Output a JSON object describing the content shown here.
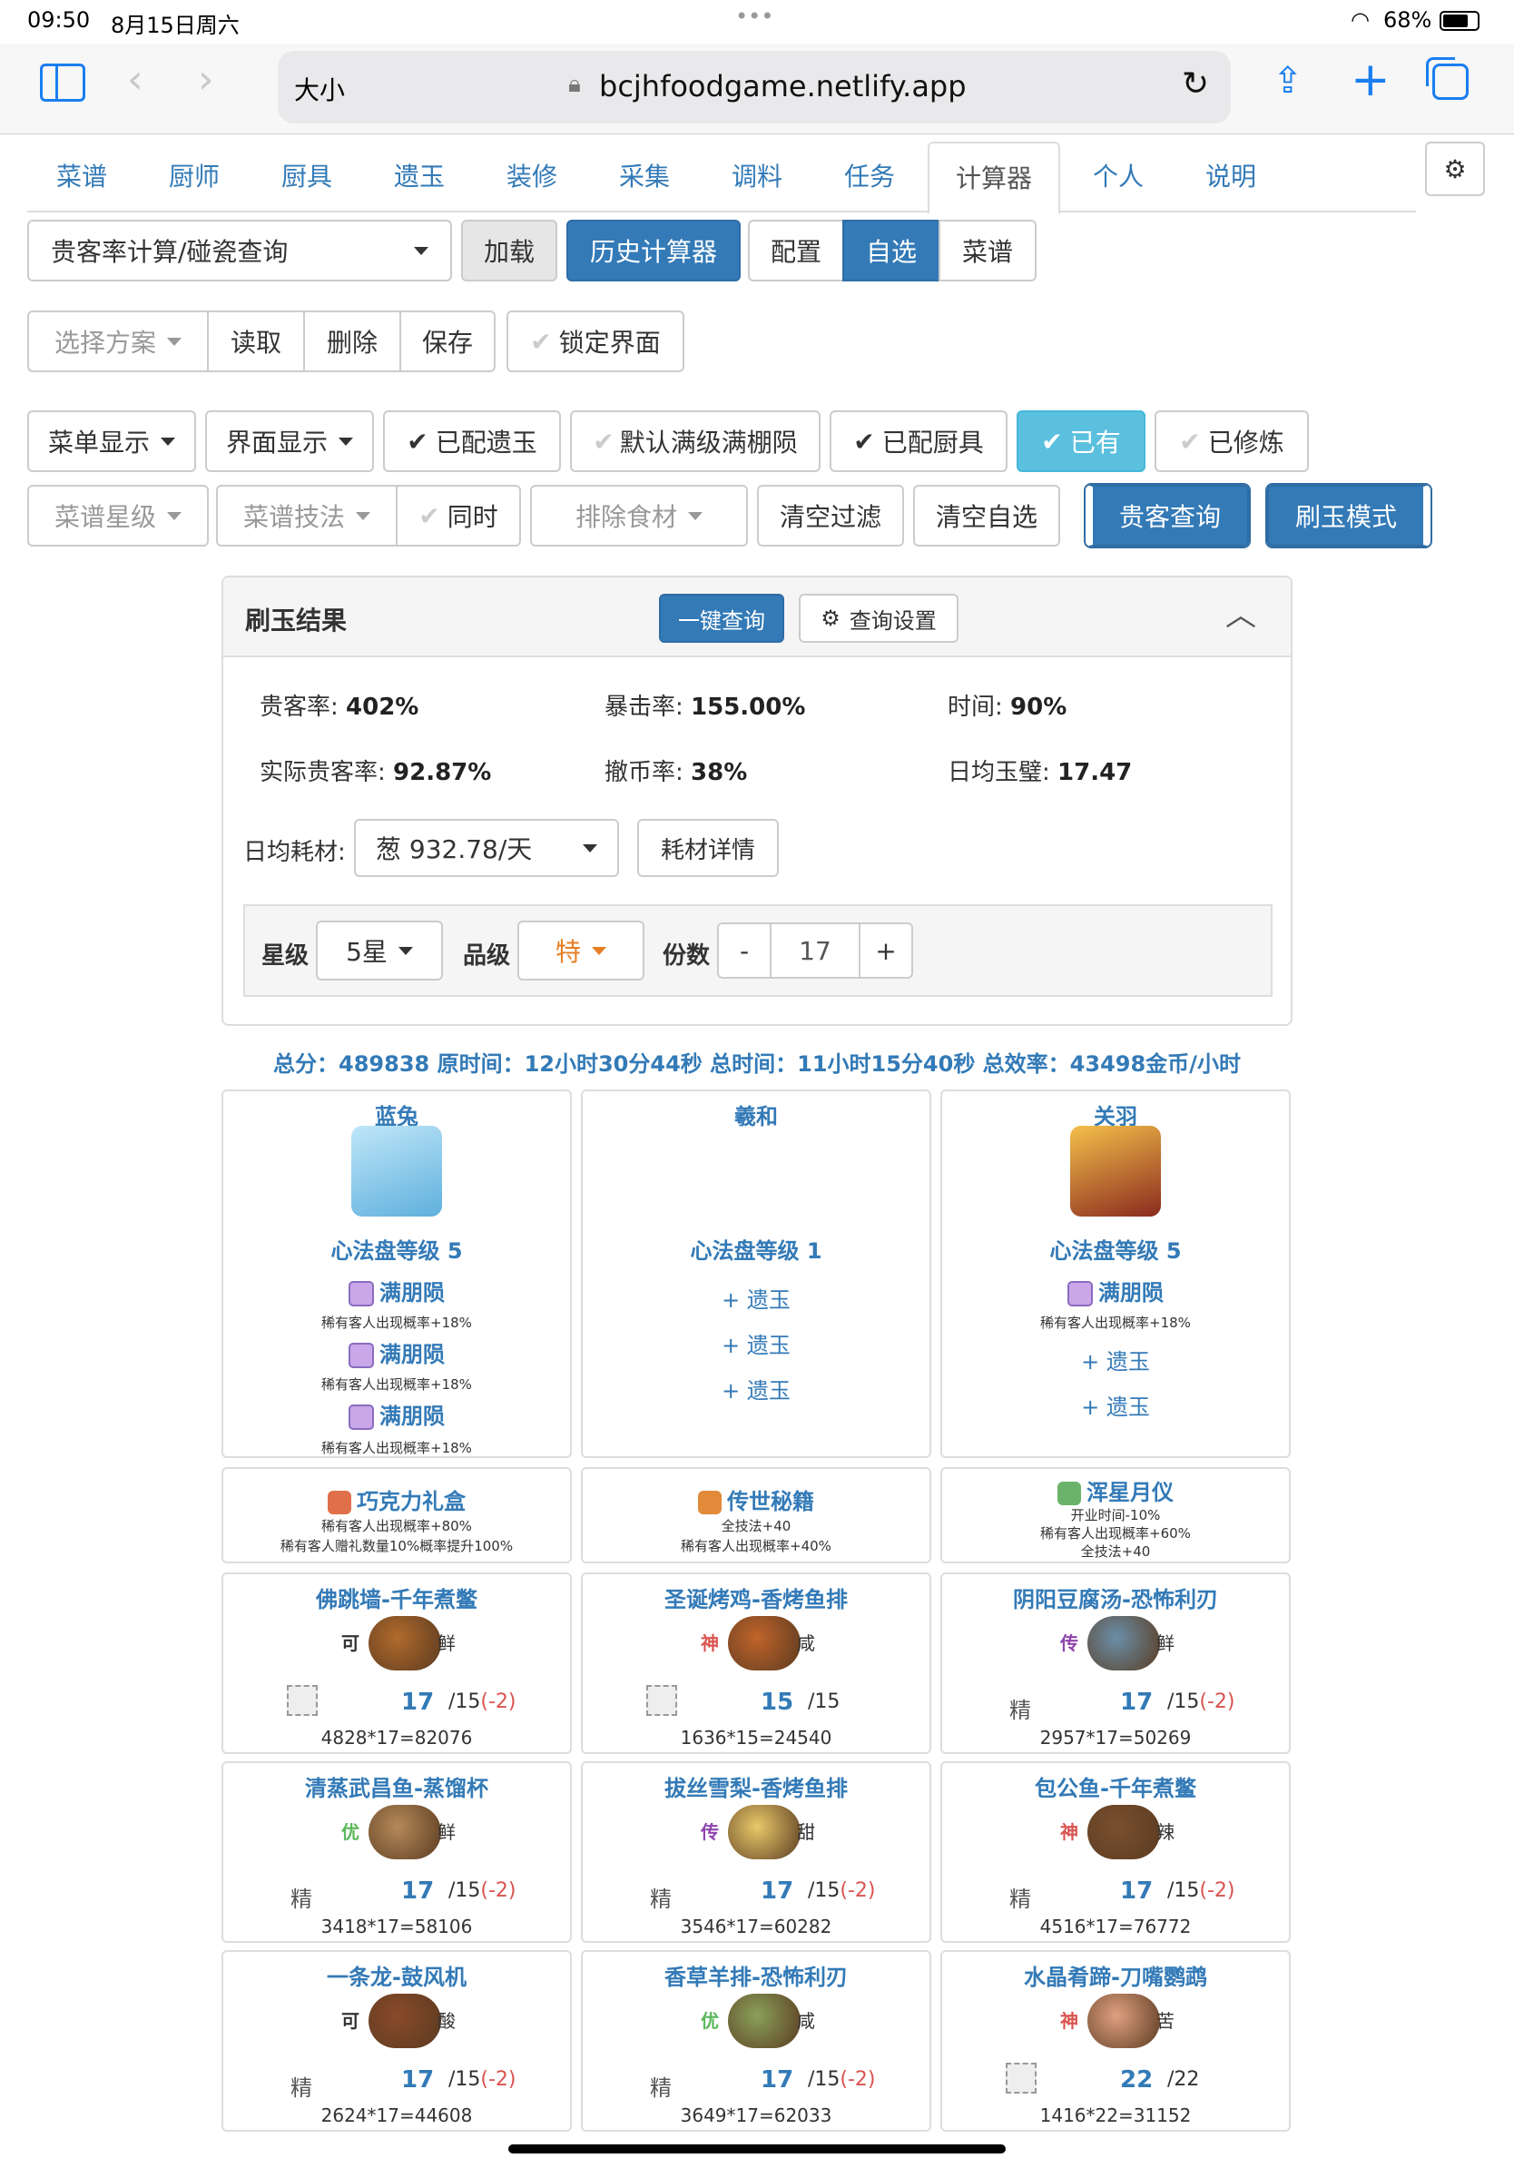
{
  "status": {
    "time": "09:50",
    "date": "8月15日周六",
    "battery": "68%"
  },
  "browser": {
    "text_size": "大小",
    "url": "bcjhfoodgame.netlify.app"
  },
  "tabs": [
    "菜谱",
    "厨师",
    "厨具",
    "遗玉",
    "装修",
    "采集",
    "调料",
    "任务",
    "计算器",
    "个人",
    "说明"
  ],
  "active_tab": "计算器",
  "row1": {
    "calc_select": "贵客率计算/碰瓷查询",
    "load": "加载",
    "history": "历史计算器",
    "config": "配置",
    "custom": "自选",
    "recipes": "菜谱"
  },
  "row2": {
    "plan": "选择方案",
    "read": "读取",
    "delete": "删除",
    "save": "保存",
    "lock": "锁定界面"
  },
  "row3": {
    "menu_display": "菜单显示",
    "ui_display": "界面显示",
    "equipped_amber": "已配遗玉",
    "default_full": "默认满级满棚陨",
    "equipped_equip": "已配厨具",
    "owned": "已有",
    "trained": "已修炼"
  },
  "row4": {
    "recipe_star": "菜谱星级",
    "recipe_skill": "菜谱技法",
    "same_time": "同时",
    "exclude": "排除食材",
    "clear_filter": "清空过滤",
    "clear_custom": "清空自选",
    "guest_query": "贵客查询",
    "amber_mode": "刷玉模式"
  },
  "panel": {
    "title": "刷玉结果",
    "one_click": "一键查询",
    "settings": "查询设置",
    "stats": [
      {
        "label": "贵客率:",
        "value": "402%"
      },
      {
        "label": "暴击率:",
        "value": "155.00%"
      },
      {
        "label": "时间:",
        "value": "90%"
      },
      {
        "label": "实际贵客率:",
        "value": "92.87%"
      },
      {
        "label": "撤币率:",
        "value": "38%"
      },
      {
        "label": "日均玉璧:",
        "value": "17.47"
      }
    ],
    "daily_label": "日均耗材:",
    "daily_value": "葱 932.78/天",
    "material_detail": "耗材详情",
    "star_label": "星级",
    "star_value": "5星",
    "grade_label": "品级",
    "grade_value": "特",
    "count_label": "份数",
    "minus": "-",
    "count_value": "17",
    "plus": "+"
  },
  "summary": "总分：489838 原时间：12小时30分44秒 总时间：11小时15分40秒 总效率：43498金币/小时",
  "chefs": [
    {
      "name": "蓝兔",
      "level": "心法盘等级 5",
      "slots": [
        {
          "name": "满朋陨",
          "desc": "稀有客人出现概率+18%"
        },
        {
          "name": "满朋陨",
          "desc": "稀有客人出现概率+18%"
        },
        {
          "name": "满朋陨",
          "desc": "稀有客人出现概率+18%"
        }
      ],
      "color": "#7cc3ea"
    },
    {
      "name": "羲和",
      "level": "心法盘等级 1",
      "slots": [
        {
          "name": "+ 遗玉"
        },
        {
          "name": "+ 遗玉"
        },
        {
          "name": "+ 遗玉"
        }
      ],
      "color": ""
    },
    {
      "name": "关羽",
      "level": "心法盘等级 5",
      "slots": [
        {
          "name": "满朋陨",
          "desc": "稀有客人出现概率+18%"
        },
        {
          "name": "+ 遗玉"
        },
        {
          "name": "+ 遗玉"
        }
      ],
      "color": "#c0392b"
    }
  ],
  "equips": [
    {
      "name": "巧克力礼盒",
      "lines": [
        "稀有客人出现概率+80%",
        "稀有客人赠礼数量10%概率提升100%"
      ]
    },
    {
      "name": "传世秘籍",
      "lines": [
        "全技法+40",
        "稀有客人出现概率+40%"
      ]
    },
    {
      "name": "浑星月仪",
      "lines": [
        "开业时间-10%",
        "稀有客人出现概率+60%",
        "全技法+40"
      ]
    }
  ],
  "dishes": [
    {
      "name": "佛跳墙-千年煮鳖",
      "rank": "可",
      "rank_color": "#333",
      "taste": "鲜",
      "cond": "",
      "count": "17",
      "max": "/15",
      "diff": "(-2)",
      "total": "4828*17=82076",
      "color": "#b06a2c"
    },
    {
      "name": "圣诞烤鸡-香烤鱼排",
      "rank": "神",
      "rank_color": "#d9534f",
      "taste": "咸",
      "cond": "",
      "count": "15",
      "max": "/15",
      "diff": "",
      "total": "1636*15=24540",
      "color": "#c0642a"
    },
    {
      "name": "阴阳豆腐汤-恐怖利刃",
      "rank": "传",
      "rank_color": "#8e44ad",
      "taste": "鲜",
      "cond": "精",
      "count": "17",
      "max": "/15",
      "diff": "(-2)",
      "total": "2957*17=50269",
      "color": "#6a8fa8"
    },
    {
      "name": "清蒸武昌鱼-蒸馏杯",
      "rank": "优",
      "rank_color": "#5cb85c",
      "taste": "鲜",
      "cond": "精",
      "count": "17",
      "max": "/15",
      "diff": "(-2)",
      "total": "3418*17=58106",
      "color": "#b58a5a"
    },
    {
      "name": "拔丝雪梨-香烤鱼排",
      "rank": "传",
      "rank_color": "#8e44ad",
      "taste": "甜",
      "cond": "精",
      "count": "17",
      "max": "/15",
      "diff": "(-2)",
      "total": "3546*17=60282",
      "color": "#e8c96a"
    },
    {
      "name": "包公鱼-千年煮鳖",
      "rank": "神",
      "rank_color": "#d9534f",
      "taste": "辣",
      "cond": "精",
      "count": "17",
      "max": "/15",
      "diff": "(-2)",
      "total": "4516*17=76772",
      "color": "#7a5030"
    },
    {
      "name": "一条龙-鼓风机",
      "rank": "可",
      "rank_color": "#333",
      "taste": "酸",
      "cond": "精",
      "count": "17",
      "max": "/15",
      "diff": "(-2)",
      "total": "2624*17=44608",
      "color": "#8a4a2a"
    },
    {
      "name": "香草羊排-恐怖利刃",
      "rank": "优",
      "rank_color": "#5cb85c",
      "taste": "咸",
      "cond": "精",
      "count": "17",
      "max": "/15",
      "diff": "(-2)",
      "total": "3649*17=62033",
      "color": "#8aa05a"
    },
    {
      "name": "水晶肴蹄-刀嘴鹦鹉",
      "rank": "神",
      "rank_color": "#d9534f",
      "taste": "苦",
      "cond": "",
      "count": "22",
      "max": "/22",
      "diff": "",
      "total": "1416*22=31152",
      "color": "#e0a080"
    }
  ]
}
